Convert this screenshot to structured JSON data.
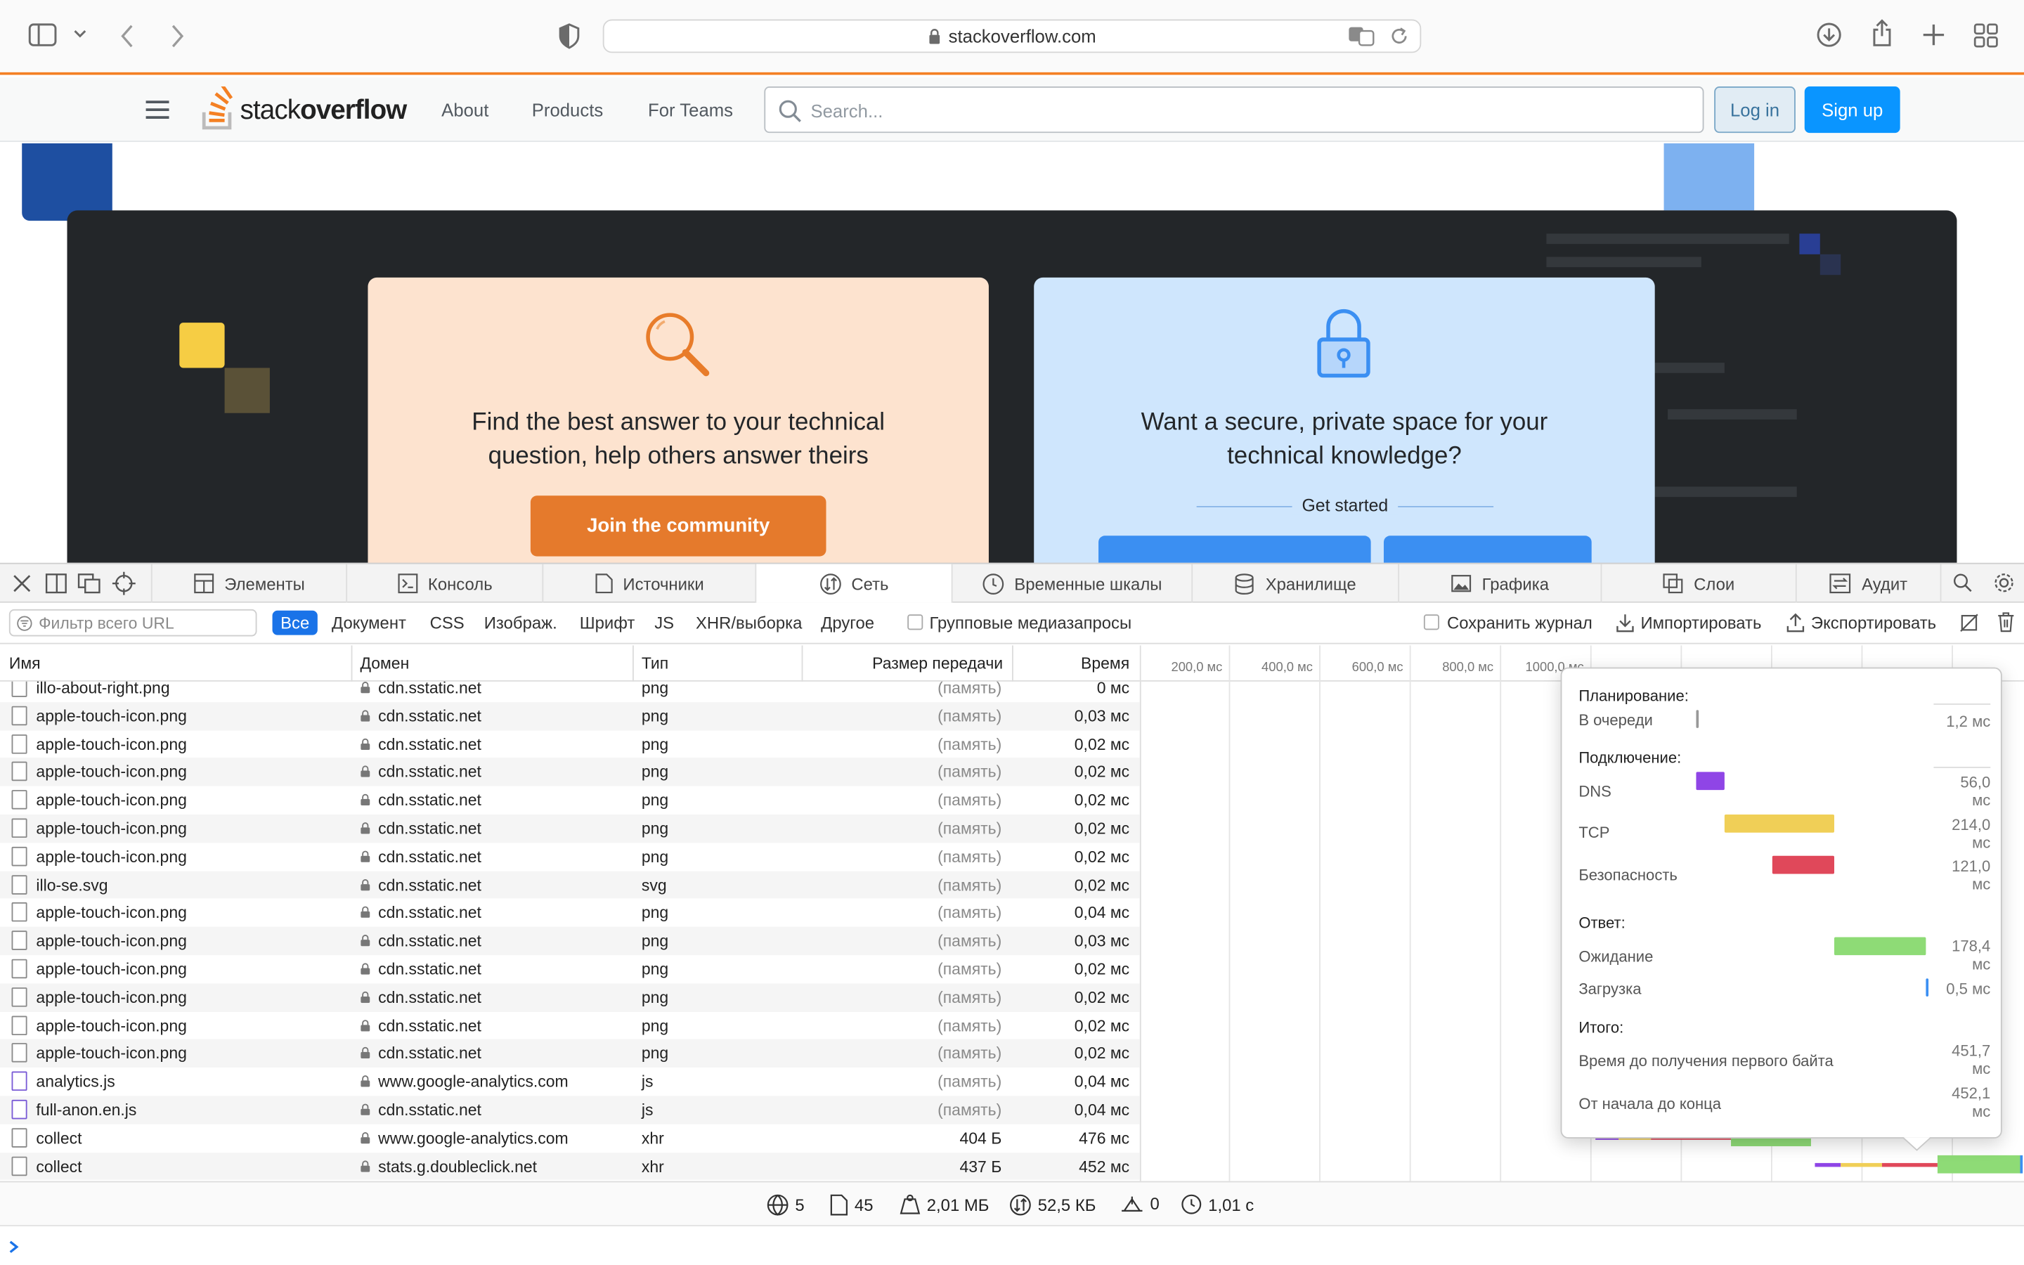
{
  "browser": {
    "url": "stackoverflow.com"
  },
  "so_header": {
    "logo_light": "stack",
    "logo_bold": "overflow",
    "nav": [
      "About",
      "Products",
      "For Teams"
    ],
    "search_placeholder": "Search...",
    "login": "Log in",
    "signup": "Sign up"
  },
  "hero": {
    "card1_text": "Find the best answer to your technical question, help others answer theirs",
    "card1_button": "Join the community",
    "card2_text": "Want a secure, private space for your technical knowledge?",
    "card2_sub": "Get started"
  },
  "devtools": {
    "tabs": [
      {
        "label": "Элементы",
        "icon": "elements-icon"
      },
      {
        "label": "Консоль",
        "icon": "console-icon"
      },
      {
        "label": "Источники",
        "icon": "sources-icon"
      },
      {
        "label": "Сеть",
        "icon": "network-icon"
      },
      {
        "label": "Временные шкалы",
        "icon": "timelines-icon"
      },
      {
        "label": "Хранилище",
        "icon": "storage-icon"
      },
      {
        "label": "Графика",
        "icon": "graphics-icon"
      },
      {
        "label": "Слои",
        "icon": "layers-icon"
      },
      {
        "label": "Аудит",
        "icon": "audit-icon"
      }
    ],
    "filter_placeholder": "Фильтр всего URL",
    "filters": [
      "Все",
      "Документ",
      "CSS",
      "Изображ.",
      "Шрифт",
      "JS",
      "XHR/выборка",
      "Другое"
    ],
    "group_media": "Групповые медиазапросы",
    "preserve_log": "Сохранить журнал",
    "import": "Импортировать",
    "export": "Экспортировать",
    "columns": [
      "Имя",
      "Домен",
      "Тип",
      "Размер передачи",
      "Время"
    ],
    "ticks": [
      "200,0 мс",
      "400,0 мс",
      "600,0 мс",
      "800,0 мс",
      "1000,0 мс"
    ],
    "rows": [
      {
        "name": "illo-about-right.png",
        "domain": "cdn.sstatic.net",
        "type": "png",
        "size": "(память)",
        "time": "0 мс"
      },
      {
        "name": "apple-touch-icon.png",
        "domain": "cdn.sstatic.net",
        "type": "png",
        "size": "(память)",
        "time": "0,03 мс"
      },
      {
        "name": "apple-touch-icon.png",
        "domain": "cdn.sstatic.net",
        "type": "png",
        "size": "(память)",
        "time": "0,02 мс"
      },
      {
        "name": "apple-touch-icon.png",
        "domain": "cdn.sstatic.net",
        "type": "png",
        "size": "(память)",
        "time": "0,02 мс"
      },
      {
        "name": "apple-touch-icon.png",
        "domain": "cdn.sstatic.net",
        "type": "png",
        "size": "(память)",
        "time": "0,02 мс"
      },
      {
        "name": "apple-touch-icon.png",
        "domain": "cdn.sstatic.net",
        "type": "png",
        "size": "(память)",
        "time": "0,02 мс"
      },
      {
        "name": "apple-touch-icon.png",
        "domain": "cdn.sstatic.net",
        "type": "png",
        "size": "(память)",
        "time": "0,02 мс"
      },
      {
        "name": "illo-se.svg",
        "domain": "cdn.sstatic.net",
        "type": "svg",
        "size": "(память)",
        "time": "0,02 мс"
      },
      {
        "name": "apple-touch-icon.png",
        "domain": "cdn.sstatic.net",
        "type": "png",
        "size": "(память)",
        "time": "0,04 мс"
      },
      {
        "name": "apple-touch-icon.png",
        "domain": "cdn.sstatic.net",
        "type": "png",
        "size": "(память)",
        "time": "0,03 мс"
      },
      {
        "name": "apple-touch-icon.png",
        "domain": "cdn.sstatic.net",
        "type": "png",
        "size": "(память)",
        "time": "0,02 мс"
      },
      {
        "name": "apple-touch-icon.png",
        "domain": "cdn.sstatic.net",
        "type": "png",
        "size": "(память)",
        "time": "0,02 мс"
      },
      {
        "name": "apple-touch-icon.png",
        "domain": "cdn.sstatic.net",
        "type": "png",
        "size": "(память)",
        "time": "0,02 мс"
      },
      {
        "name": "apple-touch-icon.png",
        "domain": "cdn.sstatic.net",
        "type": "png",
        "size": "(память)",
        "time": "0,02 мс"
      },
      {
        "name": "analytics.js",
        "domain": "www.google-analytics.com",
        "type": "js",
        "size": "(память)",
        "time": "0,04 мс"
      },
      {
        "name": "full-anon.en.js",
        "domain": "cdn.sstatic.net",
        "type": "js",
        "size": "(память)",
        "time": "0,04 мс"
      },
      {
        "name": "collect",
        "domain": "www.google-analytics.com",
        "type": "xhr",
        "size": "404 Б",
        "time": "476 мс"
      },
      {
        "name": "collect",
        "domain": "stats.g.doubleclick.net",
        "type": "xhr",
        "size": "437 Б",
        "time": "452 мс"
      }
    ],
    "popover": {
      "scheduling": "Планирование:",
      "queued": "В очереди",
      "queued_val": "1,2 мс",
      "connection": "Подключение:",
      "dns": "DNS",
      "dns_val": "56,0 мс",
      "tcp": "TCP",
      "tcp_val": "214,0 мс",
      "security": "Безопасность",
      "security_val": "121,0 мс",
      "response": "Ответ:",
      "waiting": "Ожидание",
      "waiting_val": "178,4 мс",
      "download": "Загрузка",
      "download_val": "0,5 мс",
      "totals": "Итого:",
      "ttfb": "Время до получения первого байта",
      "ttfb_val": "451,7 мс",
      "total": "От начала до конца",
      "total_val": "452,1 мс"
    },
    "status": {
      "domains": "5",
      "resources": "45",
      "transferred": "2,01 МБ",
      "size": "52,5 КБ",
      "errors": "0",
      "time": "1,01 с"
    }
  },
  "colors": {
    "so_orange": "#f48024",
    "so_blue": "#0a95ff",
    "dns": "#8f45e6",
    "tcp": "#f0cf57",
    "security": "#e0485a",
    "waiting": "#8edb76"
  }
}
